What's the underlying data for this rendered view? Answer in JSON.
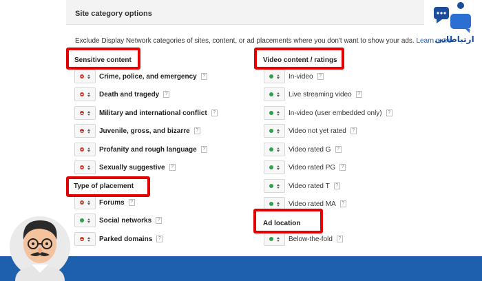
{
  "panel": {
    "title": "Site category options",
    "description": "Exclude Display Network categories of sites, content, or ad placements where you don't want to show your ads.",
    "learn_more": "Learn more"
  },
  "sections": {
    "sensitive_content": {
      "title": "Sensitive content",
      "items": [
        {
          "label": "Crime, police, and emergency",
          "state": "excluded"
        },
        {
          "label": "Death and tragedy",
          "state": "excluded"
        },
        {
          "label": "Military and international conflict",
          "state": "excluded"
        },
        {
          "label": "Juvenile, gross, and bizarre",
          "state": "excluded"
        },
        {
          "label": "Profanity and rough language",
          "state": "excluded"
        },
        {
          "label": "Sexually suggestive",
          "state": "excluded"
        }
      ]
    },
    "type_of_placement": {
      "title": "Type of placement",
      "items": [
        {
          "label": "Forums",
          "state": "excluded"
        },
        {
          "label": "Social networks",
          "state": "included"
        },
        {
          "label": "Parked domains",
          "state": "excluded"
        }
      ]
    },
    "video_content": {
      "title": "Video content / ratings",
      "items": [
        {
          "label": "In-video",
          "state": "included"
        },
        {
          "label": "Live streaming video",
          "state": "included"
        },
        {
          "label": "In-video (user embedded only)",
          "state": "included"
        },
        {
          "label": "Video not yet rated",
          "state": "included"
        },
        {
          "label": "Video rated G",
          "state": "included"
        },
        {
          "label": "Video rated PG",
          "state": "included"
        },
        {
          "label": "Video rated T",
          "state": "included"
        },
        {
          "label": "Video rated MA",
          "state": "included"
        }
      ]
    },
    "ad_location": {
      "title": "Ad location",
      "items": [
        {
          "label": "Below-the-fold",
          "state": "included"
        }
      ]
    }
  },
  "help_glyph": "?",
  "brand": {
    "text": "ارتباطاتی"
  },
  "colors": {
    "highlight": "#e40000",
    "excluded": "#d23b2e",
    "included": "#2da24b",
    "bar": "#1e60ad"
  }
}
